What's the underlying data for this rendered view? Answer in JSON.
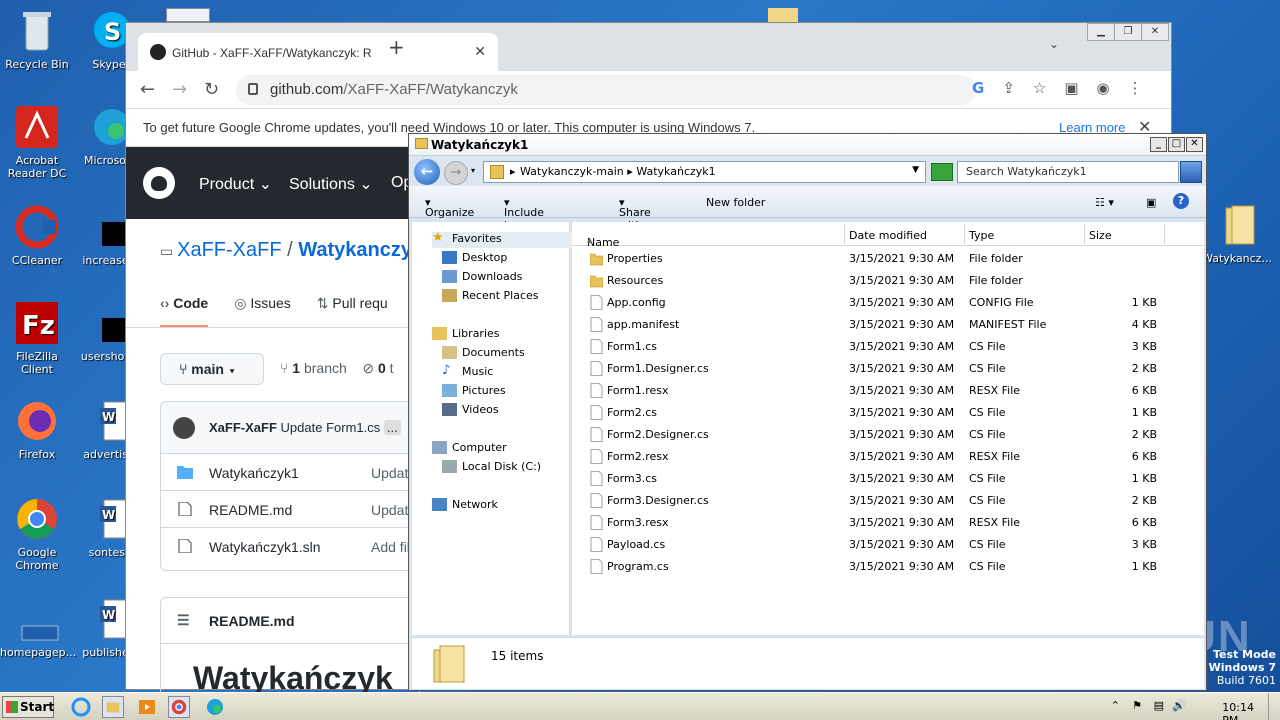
{
  "desktop": {
    "icons_left": [
      {
        "label": "Recycle Bin",
        "icon": "recycle-bin-icon"
      },
      {
        "label": "Acrobat Reader DC",
        "icon": "acrobat-icon"
      },
      {
        "label": "CCleaner",
        "icon": "ccleaner-icon"
      },
      {
        "label": "FileZilla Client",
        "icon": "filezilla-icon"
      },
      {
        "label": "Firefox",
        "icon": "firefox-icon"
      },
      {
        "label": "Google Chrome",
        "icon": "chrome-icon"
      },
      {
        "label": "homepagep...",
        "icon": "file-icon"
      }
    ],
    "icons_col2": [
      {
        "label": "Skype",
        "icon": "skype-icon"
      },
      {
        "label": "Microsoft",
        "icon": "edge-icon"
      },
      {
        "label": "increased",
        "icon": "blank-file-icon"
      },
      {
        "label": "usershosp",
        "icon": "blank-file-icon"
      },
      {
        "label": "advertise",
        "icon": "word-icon"
      },
      {
        "label": "sontest",
        "icon": "word-icon"
      },
      {
        "label": "published",
        "icon": "word-icon"
      }
    ],
    "icon_right": {
      "label": "Watykancz...",
      "icon": "folder-icon"
    },
    "watermark": "ANY RUN",
    "test_mode": [
      "Test Mode",
      "Windows 7",
      "Build 7601"
    ]
  },
  "chrome": {
    "tab_title": "GitHub - XaFF-XaFF/Watykanczyk: R",
    "url_host": "github.com",
    "url_path": "/XaFF-XaFF/Watykanczyk",
    "infobar_text": "To get future Google Chrome updates, you'll need Windows 10 or later. This computer is using Windows 7.",
    "infobar_link": "Learn more"
  },
  "github": {
    "menu": [
      "Product",
      "Solutions",
      "Op"
    ],
    "repo_owner": "XaFF-XaFF",
    "repo_sep": " / ",
    "repo_name": "Watykanczyk",
    "tabs": [
      "Code",
      "Issues",
      "Pull requ"
    ],
    "branch": "main",
    "branch_count": "1",
    "branch_label": "branch",
    "tags_count": "0",
    "tags_label": "t",
    "commit_author": "XaFF-XaFF",
    "commit_msg": "Update Form1.cs",
    "commit_more": "...",
    "files": [
      {
        "name": "Watykańczyk1",
        "msg": "Updat",
        "type": "folder"
      },
      {
        "name": "README.md",
        "msg": "Updat",
        "type": "file"
      },
      {
        "name": "Watykańczyk1.sln",
        "msg": "Add fil",
        "type": "file"
      }
    ],
    "readme_header": "README.md",
    "readme_h1": "Watykańczyk"
  },
  "explorer": {
    "title": "Watykańczyk1",
    "path": [
      "Watykanczyk-main",
      "Watykańczyk1"
    ],
    "search_placeholder": "Search Watykańczyk1",
    "toolbar": [
      "Organize",
      "Include in library",
      "Share with",
      "New folder"
    ],
    "nav": {
      "favorites": "Favorites",
      "fav_items": [
        "Desktop",
        "Downloads",
        "Recent Places"
      ],
      "libraries": "Libraries",
      "lib_items": [
        "Documents",
        "Music",
        "Pictures",
        "Videos"
      ],
      "computer": "Computer",
      "comp_items": [
        "Local Disk (C:)"
      ],
      "network": "Network"
    },
    "columns": [
      "Name",
      "Date modified",
      "Type",
      "Size"
    ],
    "files": [
      {
        "name": "Properties",
        "date": "3/15/2021 9:30 AM",
        "type": "File folder",
        "size": "",
        "folder": true
      },
      {
        "name": "Resources",
        "date": "3/15/2021 9:30 AM",
        "type": "File folder",
        "size": "",
        "folder": true
      },
      {
        "name": "App.config",
        "date": "3/15/2021 9:30 AM",
        "type": "CONFIG File",
        "size": "1 KB",
        "folder": false
      },
      {
        "name": "app.manifest",
        "date": "3/15/2021 9:30 AM",
        "type": "MANIFEST File",
        "size": "4 KB",
        "folder": false
      },
      {
        "name": "Form1.cs",
        "date": "3/15/2021 9:30 AM",
        "type": "CS File",
        "size": "3 KB",
        "folder": false
      },
      {
        "name": "Form1.Designer.cs",
        "date": "3/15/2021 9:30 AM",
        "type": "CS File",
        "size": "2 KB",
        "folder": false
      },
      {
        "name": "Form1.resx",
        "date": "3/15/2021 9:30 AM",
        "type": "RESX File",
        "size": "6 KB",
        "folder": false
      },
      {
        "name": "Form2.cs",
        "date": "3/15/2021 9:30 AM",
        "type": "CS File",
        "size": "1 KB",
        "folder": false
      },
      {
        "name": "Form2.Designer.cs",
        "date": "3/15/2021 9:30 AM",
        "type": "CS File",
        "size": "2 KB",
        "folder": false
      },
      {
        "name": "Form2.resx",
        "date": "3/15/2021 9:30 AM",
        "type": "RESX File",
        "size": "6 KB",
        "folder": false
      },
      {
        "name": "Form3.cs",
        "date": "3/15/2021 9:30 AM",
        "type": "CS File",
        "size": "1 KB",
        "folder": false
      },
      {
        "name": "Form3.Designer.cs",
        "date": "3/15/2021 9:30 AM",
        "type": "CS File",
        "size": "2 KB",
        "folder": false
      },
      {
        "name": "Form3.resx",
        "date": "3/15/2021 9:30 AM",
        "type": "RESX File",
        "size": "6 KB",
        "folder": false
      },
      {
        "name": "Payload.cs",
        "date": "3/15/2021 9:30 AM",
        "type": "CS File",
        "size": "3 KB",
        "folder": false
      },
      {
        "name": "Program.cs",
        "date": "3/15/2021 9:30 AM",
        "type": "CS File",
        "size": "1 KB",
        "folder": false
      }
    ],
    "status": "15 items"
  },
  "taskbar": {
    "start": "Start",
    "clock": "10:14 PM"
  },
  "colors": {
    "accent": "#0969da",
    "gh_header": "#24292f",
    "explorer_bg": "#d8e4f0"
  }
}
